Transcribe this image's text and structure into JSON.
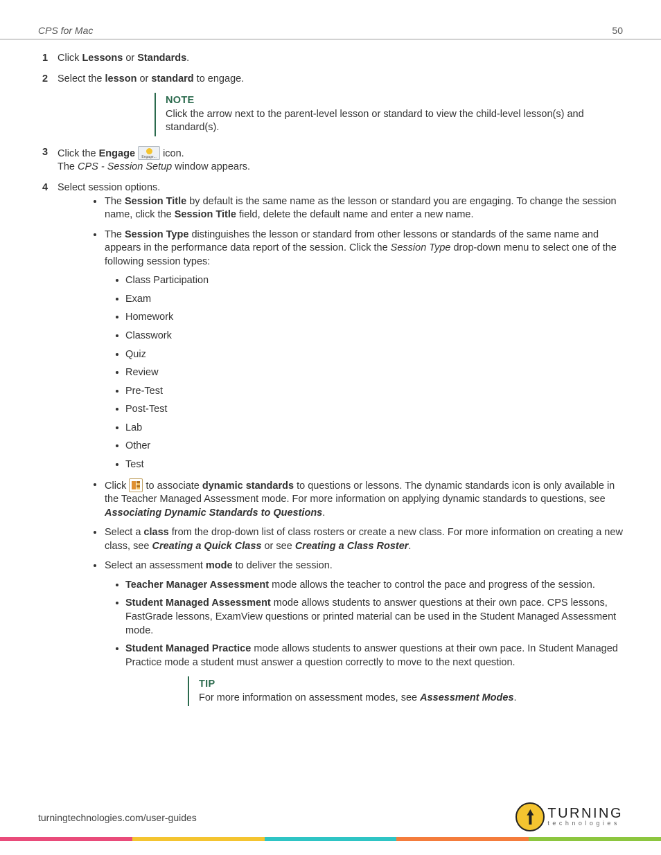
{
  "header": {
    "title": "CPS for Mac",
    "page": "50"
  },
  "steps": {
    "s1": {
      "num": "1",
      "pre": "Click ",
      "b1": "Lessons",
      "mid": " or ",
      "b2": "Standards",
      "post": "."
    },
    "s2": {
      "num": "2",
      "pre": "Select the ",
      "b1": "lesson",
      "mid": " or ",
      "b2": "standard",
      "post": " to engage."
    },
    "note": {
      "title": "NOTE",
      "text": "Click the arrow next to the parent-level lesson or standard to view the child-level lesson(s) and standard(s)."
    },
    "s3": {
      "num": "3",
      "l1a": "Click the ",
      "l1b": "Engage",
      "l1c": " icon.",
      "l2a": "The ",
      "l2i": "CPS - Session Setup",
      "l2b": " window appears."
    },
    "s4": {
      "num": "4",
      "text": "Select session options.",
      "bullets": {
        "a": {
          "t1": "The ",
          "b1": "Session Title",
          "t2": " by default is the same name as the lesson or standard you are engaging. To change the session name, click the ",
          "b2": "Session Title",
          "t3": " field, delete the default name and enter a new name."
        },
        "b": {
          "t1": "The ",
          "b1": "Session Type",
          "t2": " distinguishes the lesson or standard from other lessons or standards of the same name and appears in the performance data report of the session. Click the ",
          "i1": "Session Type",
          "t3": " drop-down menu to select one of the following session types:",
          "types": [
            "Class Participation",
            "Exam",
            "Homework",
            "Classwork",
            "Quiz",
            "Review",
            "Pre-Test",
            "Post-Test",
            "Lab",
            "Other",
            "Test"
          ]
        },
        "c": {
          "t1": "Click ",
          "t2": " to associate ",
          "b1": "dynamic standards",
          "t3": " to questions or lessons. The dynamic standards icon is only available in the Teacher Managed Assessment mode. For more information on applying dynamic standards to questions, see ",
          "bi1": "Associating Dynamic Standards to Questions",
          "t4": "."
        },
        "d": {
          "t1": "Select a ",
          "b1": "class",
          "t2": " from the drop-down list of class rosters or create a new class. For more information on creating a new class, see ",
          "bi1": "Creating a Quick Class",
          "t3": " or see ",
          "bi2": "Creating a Class Roster",
          "t4": "."
        },
        "e": {
          "t1": "Select an assessment ",
          "b1": "mode",
          "t2": " to deliver the session.",
          "modes": {
            "m1": {
              "b": "Teacher Manager Assessment",
              "t": " mode allows the teacher to control the pace and progress of the session."
            },
            "m2": {
              "b": "Student Managed Assessment",
              "t": " mode allows students to answer questions at their own pace. CPS lessons, FastGrade lessons, ExamView questions or printed material can be used in the Student Managed Assessment mode."
            },
            "m3": {
              "b": "Student Managed Practice",
              "t": " mode allows students to answer questions at their own pace. In Student Managed Practice mode a student must answer a question correctly to move to the next question."
            }
          },
          "tip": {
            "title": "TIP",
            "t1": "For more information on assessment modes, see ",
            "bi": "Assessment Modes",
            "t2": "."
          }
        }
      }
    }
  },
  "footer": {
    "url": "turningtechnologies.com/user-guides",
    "logo1": "TURNING",
    "logo2": "technologies"
  }
}
